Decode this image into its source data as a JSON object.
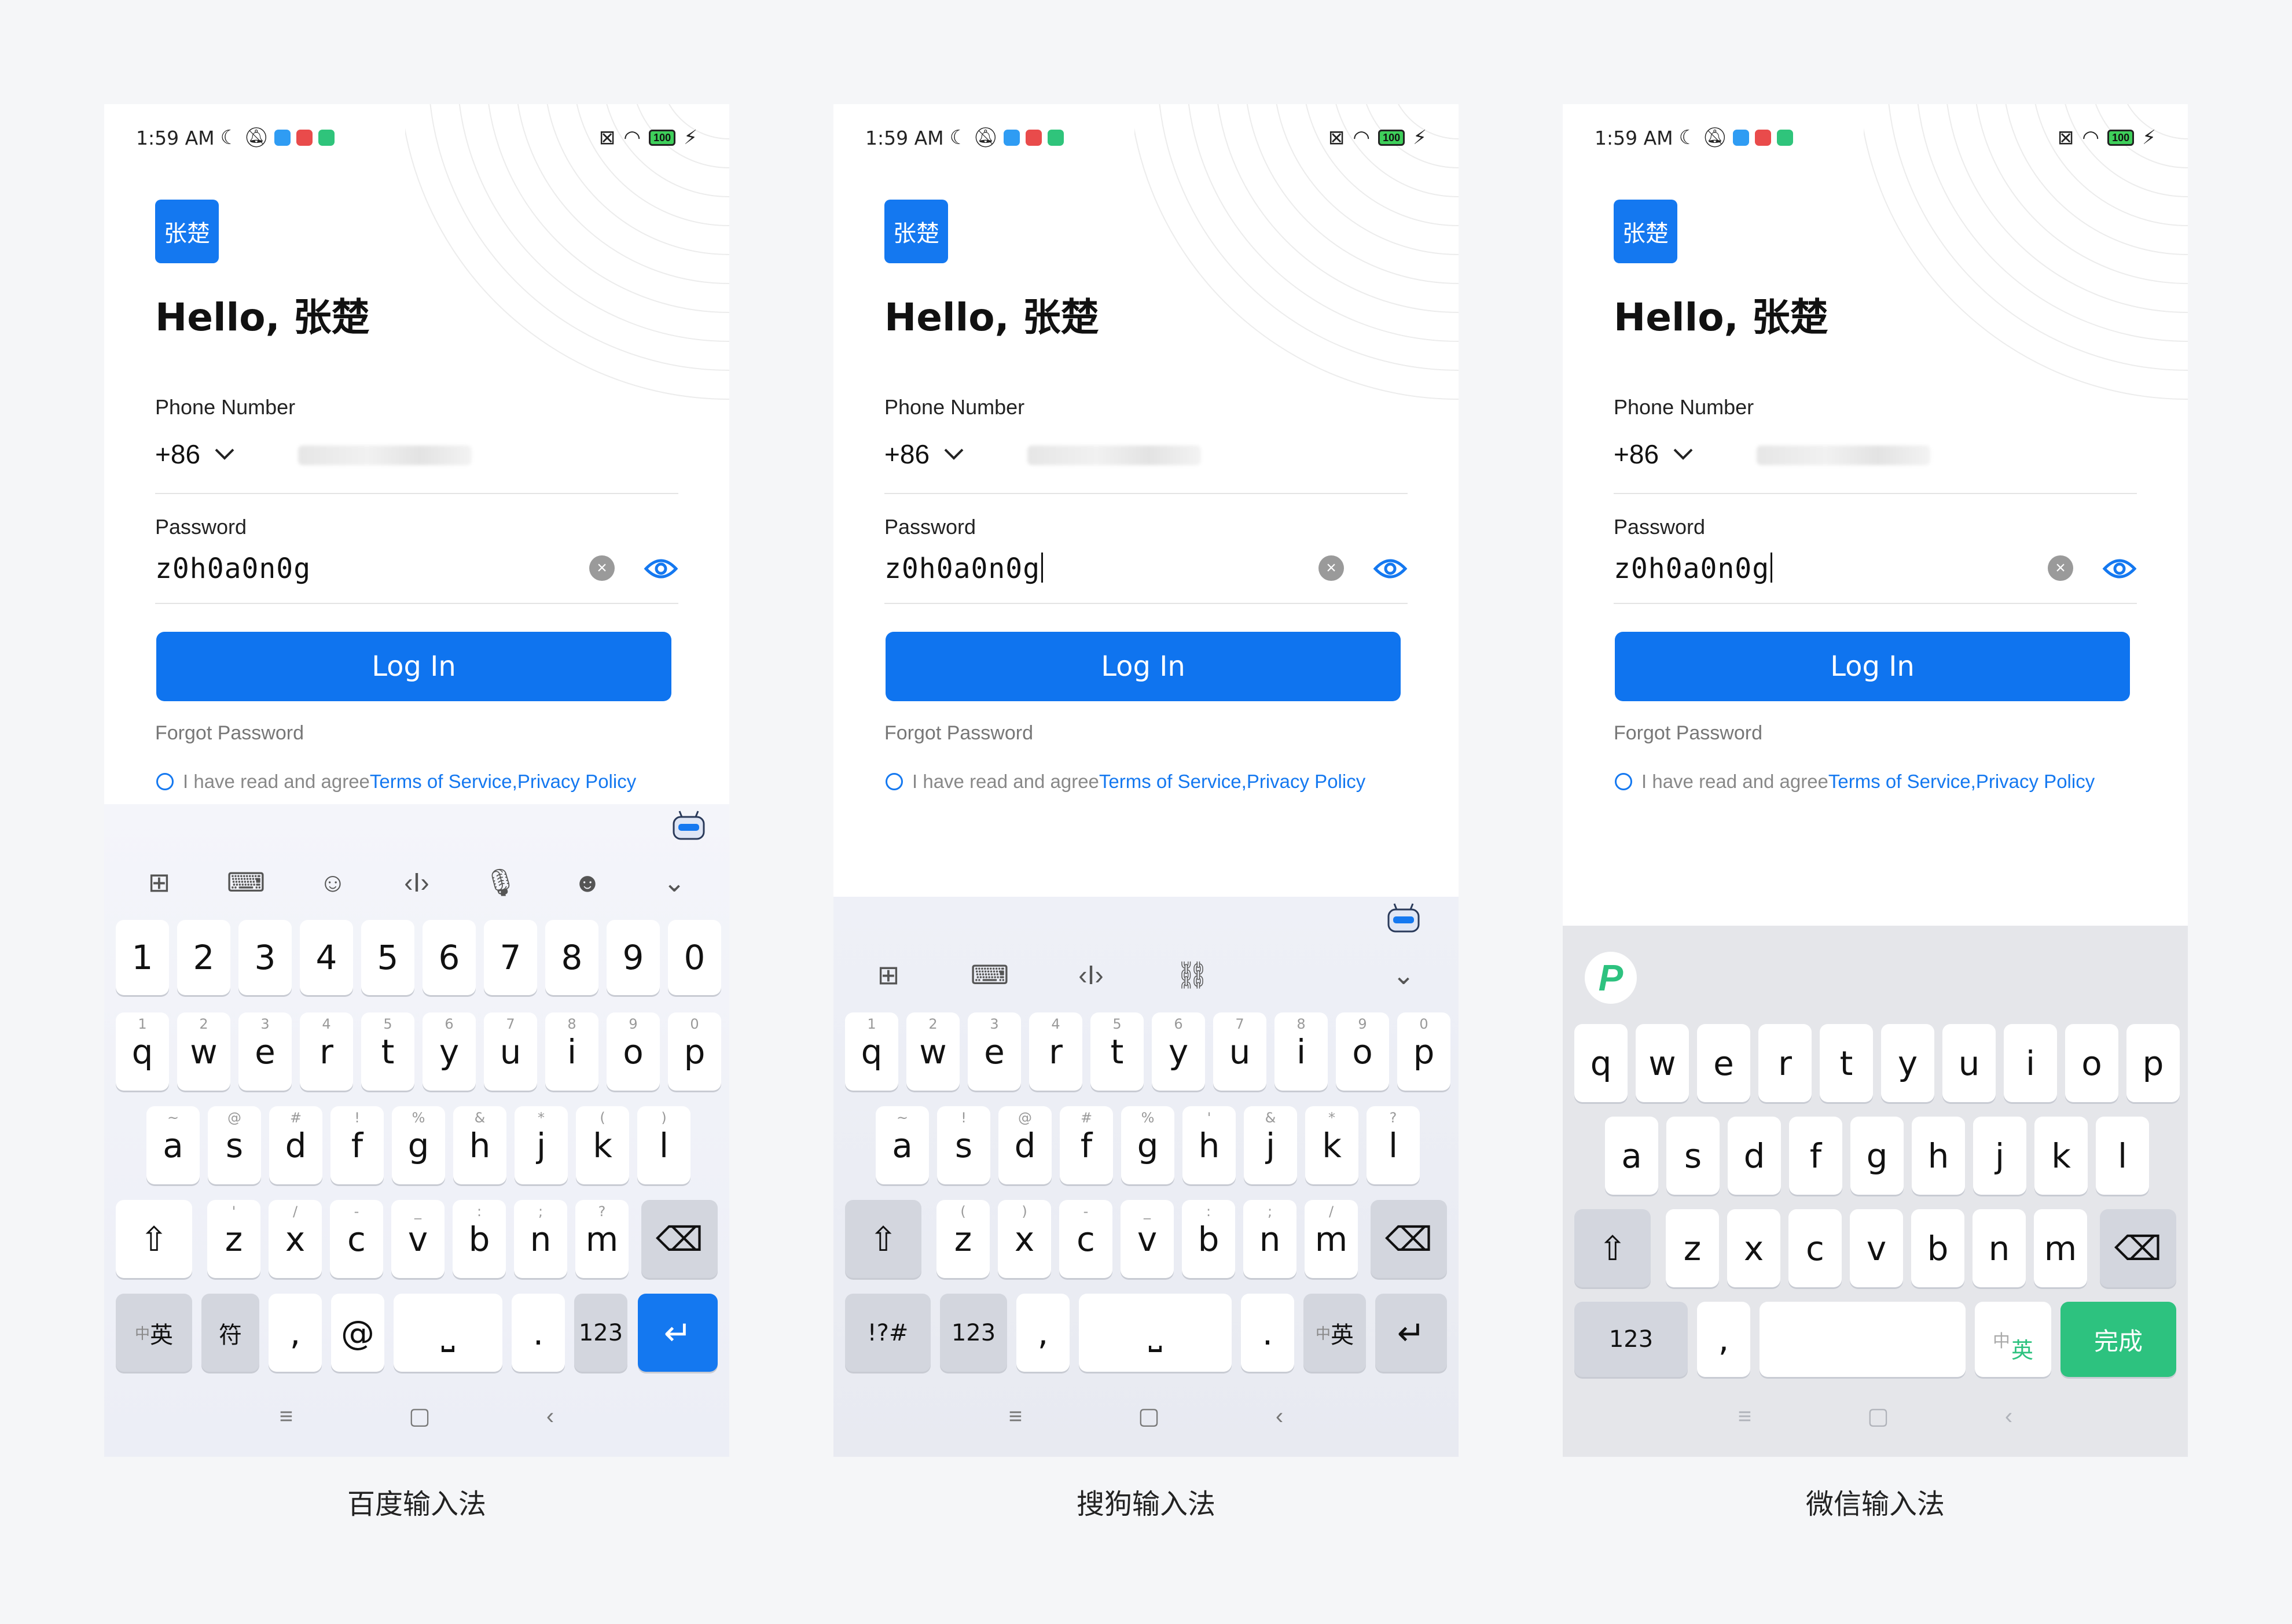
{
  "status": {
    "time": "1:59 AM",
    "battery": "100"
  },
  "avatar": "张楚",
  "greeting": "Hello, 张楚",
  "phone_label": "Phone Number",
  "country_code": "+86",
  "password_label": "Password",
  "password_value": "z0h0a0n0g",
  "login_label": "Log In",
  "forgot_label": "Forgot Password",
  "agree": {
    "prefix": "I have read and agree",
    "terms": "Terms of Service",
    "sep": ", ",
    "privacy": "Privacy Policy"
  },
  "captions": [
    "百度输入法",
    "搜狗输入法",
    "微信输入法"
  ],
  "baidu": {
    "numbers": [
      "1",
      "2",
      "3",
      "4",
      "5",
      "6",
      "7",
      "8",
      "9",
      "0"
    ],
    "row1": [
      "q",
      "w",
      "e",
      "r",
      "t",
      "y",
      "u",
      "i",
      "o",
      "p"
    ],
    "row1_hints": [
      "1",
      "2",
      "3",
      "4",
      "5",
      "6",
      "7",
      "8",
      "9",
      "0"
    ],
    "row2": [
      "a",
      "s",
      "d",
      "f",
      "g",
      "h",
      "j",
      "k",
      "l"
    ],
    "row2_hints": [
      "~",
      "@",
      "#",
      "!",
      "%",
      "&",
      "*",
      "(",
      ")"
    ],
    "row3": [
      "z",
      "x",
      "c",
      "v",
      "b",
      "n",
      "m"
    ],
    "row3_hints": [
      "'",
      "/",
      "-",
      "_",
      ":",
      ";",
      "?"
    ],
    "bottom": {
      "lang": "英",
      "lang_prefix": "中",
      "symbols": "符",
      "comma": ",",
      "at": "@",
      "period": ".",
      "num": "123"
    }
  },
  "sogou": {
    "row1": [
      "q",
      "w",
      "e",
      "r",
      "t",
      "y",
      "u",
      "i",
      "o",
      "p"
    ],
    "row1_hints": [
      "1",
      "2",
      "3",
      "4",
      "5",
      "6",
      "7",
      "8",
      "9",
      "0"
    ],
    "row2": [
      "a",
      "s",
      "d",
      "f",
      "g",
      "h",
      "j",
      "k",
      "l"
    ],
    "row2_hints": [
      "~",
      "!",
      "@",
      "#",
      "%",
      "'",
      "&",
      "*",
      "?"
    ],
    "row3": [
      "z",
      "x",
      "c",
      "v",
      "b",
      "n",
      "m"
    ],
    "row3_hints": [
      "(",
      ")",
      "-",
      "_",
      ":",
      ";",
      "/"
    ],
    "bottom": {
      "symbols": "!?#",
      "num": "123",
      "comma": ",",
      "period": ".",
      "lang_prefix": "中",
      "lang": "英"
    }
  },
  "wechat": {
    "row1": [
      "q",
      "w",
      "e",
      "r",
      "t",
      "y",
      "u",
      "i",
      "o",
      "p"
    ],
    "row2": [
      "a",
      "s",
      "d",
      "f",
      "g",
      "h",
      "j",
      "k",
      "l"
    ],
    "row3": [
      "z",
      "x",
      "c",
      "v",
      "b",
      "n",
      "m"
    ],
    "bottom": {
      "num": "123",
      "punct": ",",
      "lang_top": "中",
      "lang_bottom": "英",
      "done": "完成"
    }
  }
}
